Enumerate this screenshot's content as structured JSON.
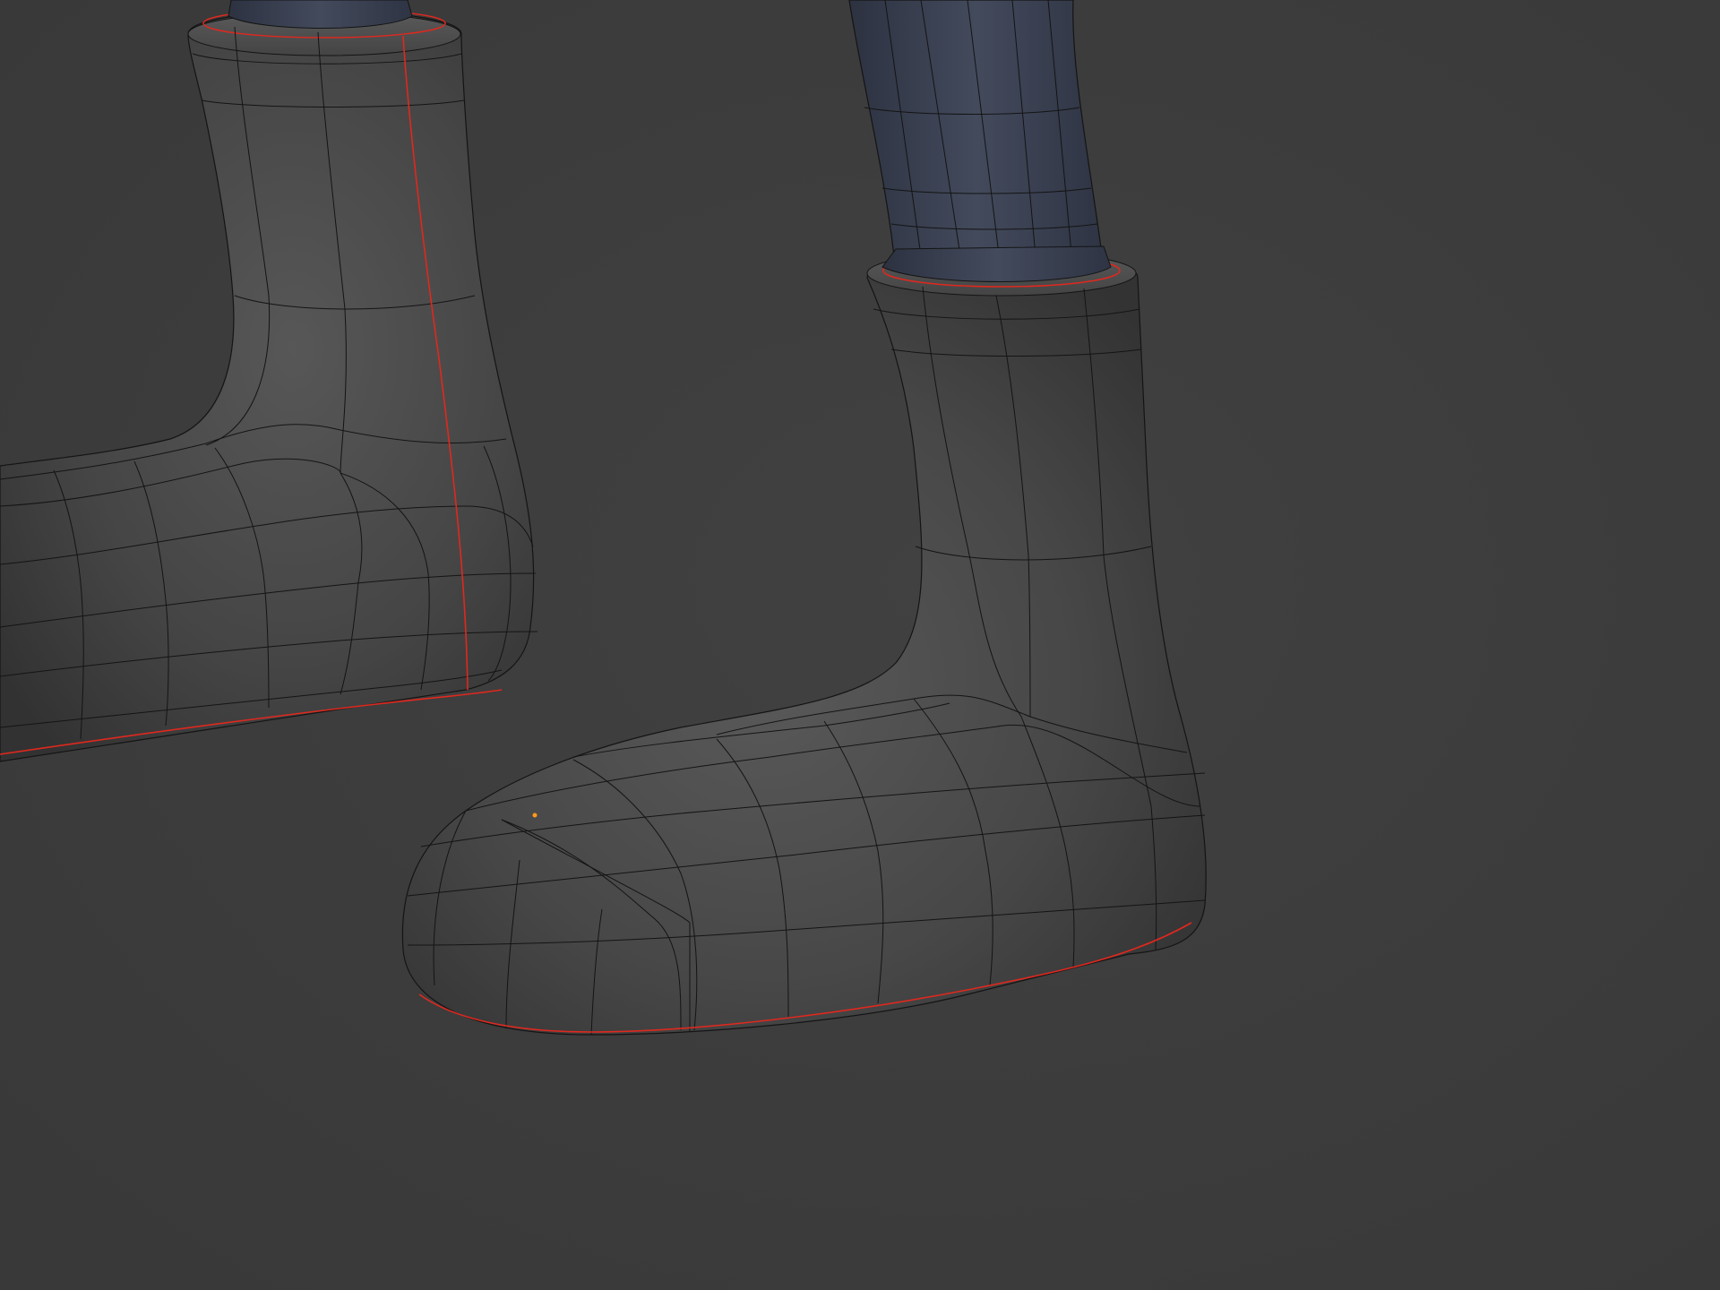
{
  "viewport": {
    "background_color": "#3c3c3c",
    "mesh_color": "#4a4a4a",
    "mesh_shade_color": "#3a3a3a",
    "wire_color": "#141414",
    "seam_color": "#e0281e",
    "leg_color": "#3b4252",
    "vertex_color": "#ff9a1a"
  },
  "objects": [
    {
      "name": "boot-left",
      "type": "mesh",
      "shading": "solid-wireframe"
    },
    {
      "name": "boot-right",
      "type": "mesh",
      "shading": "solid-wireframe"
    },
    {
      "name": "leg-left",
      "type": "mesh",
      "shading": "solid-wireframe"
    },
    {
      "name": "leg-right",
      "type": "mesh",
      "shading": "solid-wireframe"
    }
  ]
}
